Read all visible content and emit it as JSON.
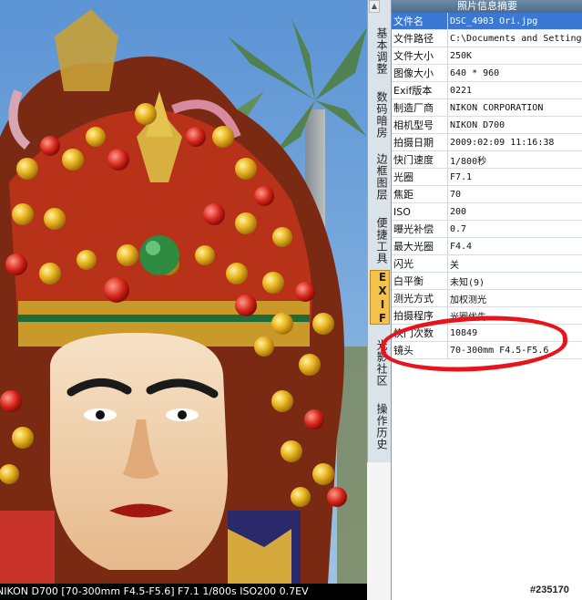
{
  "panel": {
    "title": "照片信息摘要",
    "rows": [
      {
        "key": "文件名",
        "value": "DSC_4903 Ori.jpg"
      },
      {
        "key": "文件路径",
        "value": "C:\\Documents and Settings"
      },
      {
        "key": "文件大小",
        "value": "250K"
      },
      {
        "key": "图像大小",
        "value": "640 * 960"
      },
      {
        "key": "Exif版本",
        "value": "0221"
      },
      {
        "key": "制造厂商",
        "value": "NIKON CORPORATION"
      },
      {
        "key": "相机型号",
        "value": "NIKON D700"
      },
      {
        "key": "拍摄日期",
        "value": "2009:02:09 11:16:38"
      },
      {
        "key": "快门速度",
        "value": "1/800秒"
      },
      {
        "key": "光圈",
        "value": "F7.1"
      },
      {
        "key": "焦距",
        "value": "70"
      },
      {
        "key": "ISO",
        "value": "200"
      },
      {
        "key": "曝光补偿",
        "value": "0.7"
      },
      {
        "key": "最大光圈",
        "value": "F4.4"
      },
      {
        "key": "闪光",
        "value": "关"
      },
      {
        "key": "白平衡",
        "value": "未知(9)"
      },
      {
        "key": "测光方式",
        "value": "加权测光"
      },
      {
        "key": "拍摄程序",
        "value": "光圈优先"
      },
      {
        "key": "快门次数",
        "value": "10849"
      },
      {
        "key": "镜头",
        "value": "70-300mm F4.5-F5.6"
      }
    ]
  },
  "tabs": [
    {
      "label": "基本调整",
      "active": false
    },
    {
      "label": "数码暗房",
      "active": false
    },
    {
      "label": "边框图层",
      "active": false
    },
    {
      "label": "便捷工具",
      "active": false
    },
    {
      "label": "EXIF",
      "active": true
    },
    {
      "label": "光影社区",
      "active": false
    },
    {
      "label": "操作历史",
      "active": false
    }
  ],
  "photo": {
    "caption": "NIKON D700 [70-300mm F4.5-F5.6] F7.1 1/800s ISO200 0.7EV"
  },
  "watermark": "#235170",
  "colors": {
    "panel_title_bg": "#5a7896",
    "active_tab": "#f6c24a",
    "highlight_row": "#3a78d4",
    "annotation_red": "#e8141b"
  }
}
